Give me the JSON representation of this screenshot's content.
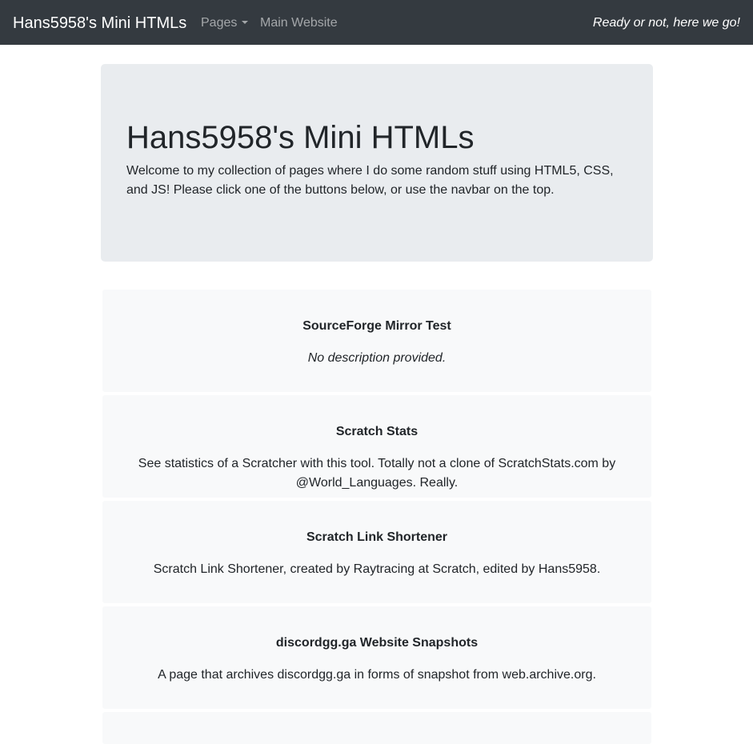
{
  "navbar": {
    "brand": "Hans5958's Mini HTMLs",
    "pages_label": "Pages",
    "main_website_label": "Main Website",
    "tagline": "Ready or not, here we go!",
    "background": "#343a40"
  },
  "jumbotron": {
    "title": "Hans5958's Mini HTMLs",
    "lead": "Welcome to my collection of pages where I do some random stuff using HTML5, CSS, and JS! Please click one of the buttons below, or use the navbar on the top.",
    "background": "#e9ecef"
  },
  "cards": [
    {
      "title": "SourceForge Mirror Test",
      "description": "No description provided."
    },
    {
      "title": "Scratch Stats",
      "description": "See statistics of a Scratcher with this tool. Totally not a clone of ScratchStats.com by @World_Languages. Really."
    },
    {
      "title": "Scratch Link Shortener",
      "description": "Scratch Link Shortener, created by Raytracing at Scratch, edited by Hans5958."
    },
    {
      "title": "discordgg.ga Website Snapshots",
      "description": "A page that archives discordgg.ga in forms of snapshot from web.archive.org."
    }
  ],
  "card_background": "#f8f9fa"
}
